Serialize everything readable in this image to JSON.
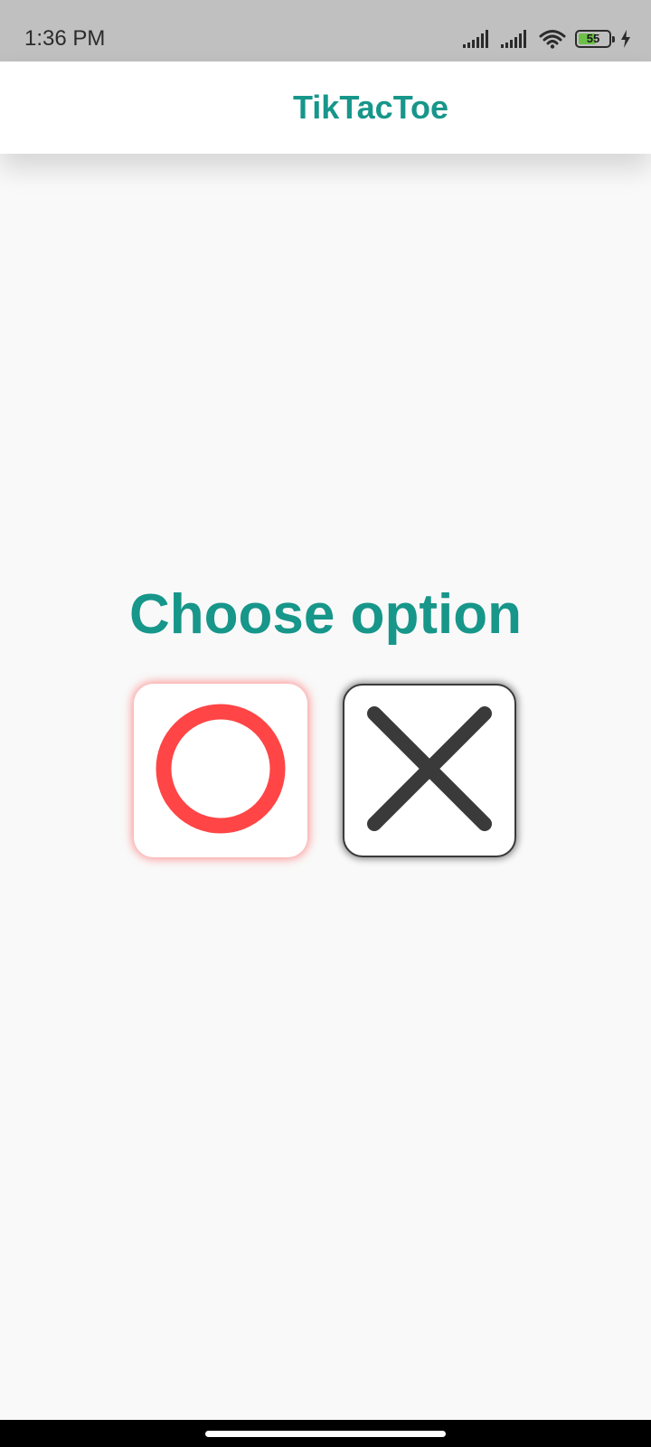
{
  "status_bar": {
    "time": "1:36 PM",
    "battery_level": "55",
    "icons": [
      "signal-icon",
      "signal-icon",
      "wifi-icon",
      "battery-icon",
      "charging-icon"
    ]
  },
  "app_bar": {
    "title": "TikTacToe"
  },
  "main": {
    "prompt": "Choose option",
    "options": [
      {
        "id": "O",
        "icon": "circle-o-icon",
        "color": "#ff4545",
        "selected": true
      },
      {
        "id": "X",
        "icon": "cross-x-icon",
        "color": "#3a3a3a",
        "selected": false
      }
    ]
  },
  "colors": {
    "accent": "#17968a",
    "o_mark": "#ff4545",
    "x_mark": "#3a3a3a",
    "status_bar_bg": "#c0c0c0",
    "background": "#f9f9f9"
  }
}
